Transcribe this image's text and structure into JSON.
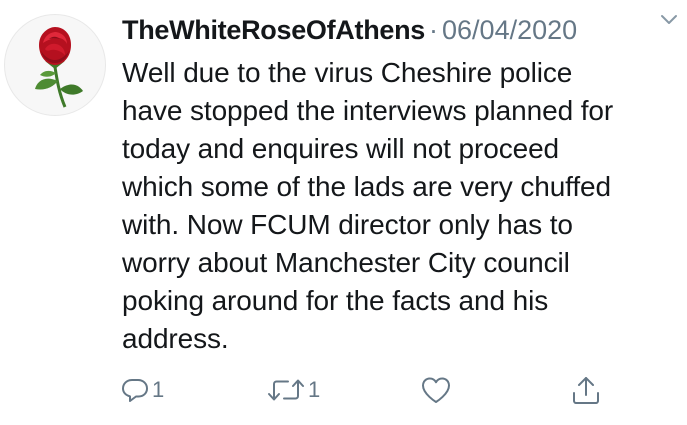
{
  "tweet": {
    "display_name": "TheWhiteRoseOfAthens",
    "separator": "·",
    "date": "06/04/2020",
    "text": "Well due to the virus Cheshire police\nhave stopped the interviews planned for\ntoday and enquires will not proceed\nwhich some of the lads are very chuffed\nwith. Now  FCUM director only has to\nworry about Manchester City council\npoking around for the facts and his\naddress.",
    "avatar_icon": "red-rose-icon"
  },
  "actions": {
    "reply_count": "1",
    "retweet_count": "1",
    "like_count": "",
    "icons": [
      "reply-icon",
      "retweet-icon",
      "like-icon",
      "share-icon"
    ]
  },
  "colors": {
    "text": "#14171a",
    "secondary": "#657786",
    "rose": "#c8102e",
    "stem": "#3f7a2a"
  }
}
